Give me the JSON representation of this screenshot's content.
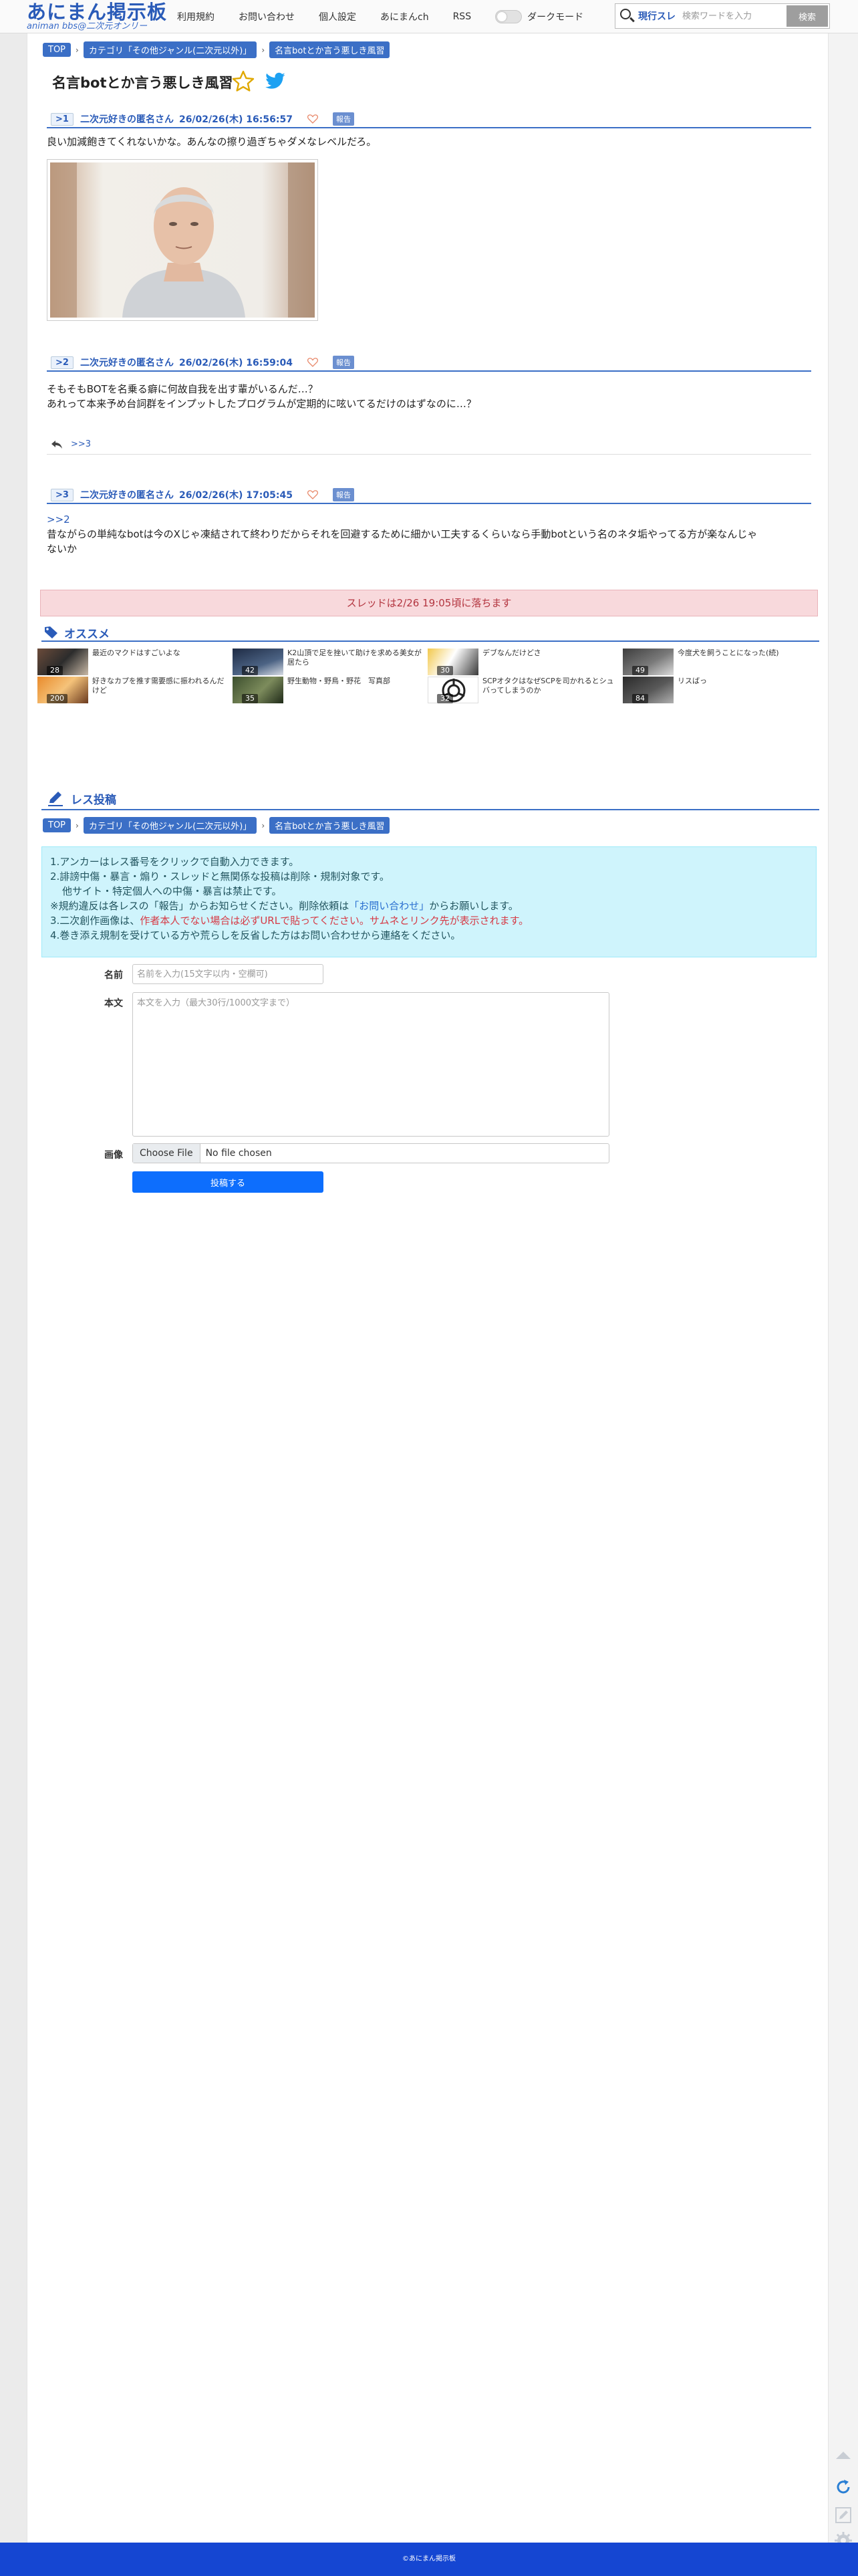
{
  "header": {
    "logo_main": "あにまん掲示板",
    "logo_sub": "animan bbs@二次元オンリー",
    "nav": [
      "利用規約",
      "お問い合わせ",
      "個人設定",
      "あにまんch",
      "RSS"
    ],
    "dark_mode_label": "ダークモード",
    "search_scope": "現行スレ",
    "search_placeholder": "検索ワードを入力",
    "search_button": "検索"
  },
  "breadcrumbs": [
    "TOP",
    "カテゴリ「その他ジャンル(二次元以外)」",
    "名言botとか言う悪しき風習"
  ],
  "thread": {
    "title": "名言botとか言う悪しき風習"
  },
  "posts": [
    {
      "num": ">1",
      "name": "二次元好きの匿名さん",
      "date": "26/02/26(木) 16:56:57",
      "report": "報告",
      "lines": [
        "良い加減飽きてくれないかな。あんなの擦り過ぎちゃダメなレベルだろ。"
      ]
    },
    {
      "num": ">2",
      "name": "二次元好きの匿名さん",
      "date": "26/02/26(木) 16:59:04",
      "report": "報告",
      "lines": [
        "そもそもBOTを名乗る癖に何故自我を出す輩がいるんだ…？",
        "あれって本来予め台詞群をインプットしたプログラムが定期的に呟いてるだけのはずなのに…？"
      ],
      "reply_link": ">>3"
    },
    {
      "num": ">3",
      "name": "二次元好きの匿名さん",
      "date": "26/02/26(木) 17:05:45",
      "report": "報告",
      "anchor": ">>2",
      "lines": [
        "昔ながらの単純なbotは今のXじゃ凍結されて終わりだからそれを回避するために細かい工夫するくらいなら手動botという名のネタ垢やってる方が楽なんじゃ",
        "ないか"
      ]
    }
  ],
  "expire_notice": "スレッドは2/26 19:05頃に落ちます",
  "recommend": {
    "title": "オススメ",
    "items": [
      {
        "count": "28",
        "text": "最近のマクドはすごいよな"
      },
      {
        "count": "42",
        "text": "K2山頂で足を挫いて助けを求める美女が居たら"
      },
      {
        "count": "30",
        "text": "デブなんだけどさ"
      },
      {
        "count": "49",
        "text": "今度犬を飼うことになった(続)"
      },
      {
        "count": "200",
        "text": "好きなカプを推す需要感に振われるんだけど"
      },
      {
        "count": "35",
        "text": "野生動物・野鳥・野花　写真部"
      },
      {
        "count": "32",
        "text": "SCPオタクはなぜSCPを司かれるとシュバってしまうのか"
      },
      {
        "count": "84",
        "text": "リスばっ"
      }
    ]
  },
  "form": {
    "title": "レス投稿",
    "rules": {
      "r1": "1.アンカーはレス番号をクリックで自動入力できます。",
      "r2": "2.誹謗中傷・暴言・煽り・スレッドと無関係な投稿は削除・規制対象です。",
      "r2b": "他サイト・特定個人への中傷・暴言は禁止です。",
      "r3a": "※規約違反は各レスの「報告」からお知らせください。削除依頼は",
      "r3b": "「お問い合わせ」",
      "r3c": "からお願いします。",
      "r4a": "3.二次創作画像は、",
      "r4b": "作者本人でない場合は必ずURLで貼ってください。サムネとリンク先が表示されます。",
      "r5": "4.巻き添え規制を受けている方や荒らしを反省した方はお問い合わせから連絡をください。"
    },
    "name_label": "名前",
    "name_placeholder": "名前を入力(15文字以内・空欄可)",
    "body_label": "本文",
    "body_placeholder": "本文を入力（最大30行/1000文字まで）",
    "image_label": "画像",
    "file_button": "Choose File",
    "file_status": "No file chosen",
    "submit": "投稿する"
  },
  "footer": "©あにまん掲示板",
  "colors": {
    "accent": "#3b6fc6",
    "link": "#2a5bb8",
    "notice_bg": "#f8d9dc",
    "rules_bg": "#cff4fc",
    "submit": "#0d6efd",
    "footer": "#1546d2"
  }
}
